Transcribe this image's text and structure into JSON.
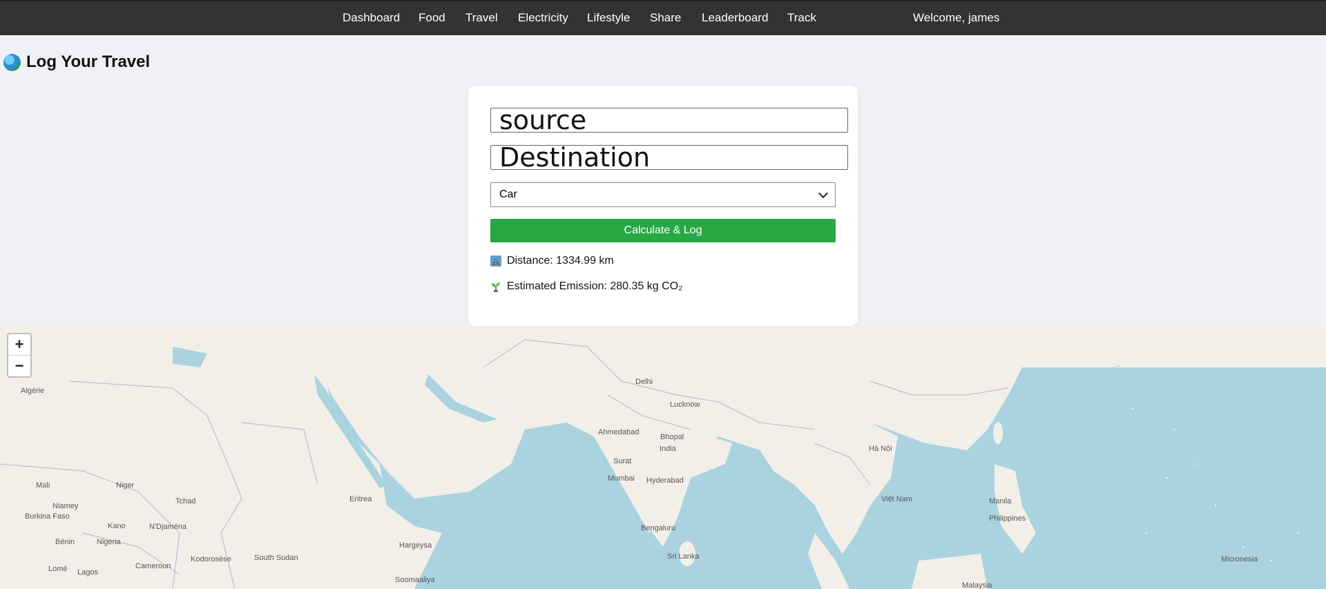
{
  "nav": {
    "items": [
      "Dashboard",
      "Food",
      "Travel",
      "Electricity",
      "Lifestyle",
      "Share",
      "Leaderboard",
      "Track"
    ],
    "welcome": "Welcome, james"
  },
  "page": {
    "title": "Log Your Travel"
  },
  "form": {
    "source_placeholder": "source",
    "destination_placeholder": "Destination",
    "mode_selected": "Car",
    "submit_label": "Calculate & Log"
  },
  "results": {
    "distance": "Distance: 1334.99 km",
    "emission": "Estimated Emission: 280.35 kg CO₂"
  },
  "map": {
    "zoom_in": "+",
    "zoom_out": "−",
    "labels": [
      "Delhi",
      "Lucknow",
      "Ahmedabad",
      "Bhopal",
      "India",
      "Surat",
      "Mumbai",
      "Hyderabad",
      "Bengaluru",
      "Sri Lanka",
      "Manila",
      "Philippines",
      "Micronesia",
      "Malaysia",
      "Mali",
      "Niger",
      "Niamey",
      "Burkina Faso",
      "Kano",
      "Bénin",
      "Nigeria",
      "Lagos",
      "Lomé",
      "N'Djaména",
      "Cameroun",
      "South Sudan",
      "Hargeysa",
      "Soomaaliya",
      "Eritrea",
      "Việt Nam",
      "Hà Nội",
      "Algérie",
      "Tchad",
      "Kodorosése"
    ],
    "colors": {
      "sea": "#aad3df",
      "land": "#f2efe9",
      "border": "#b09fc6"
    }
  }
}
